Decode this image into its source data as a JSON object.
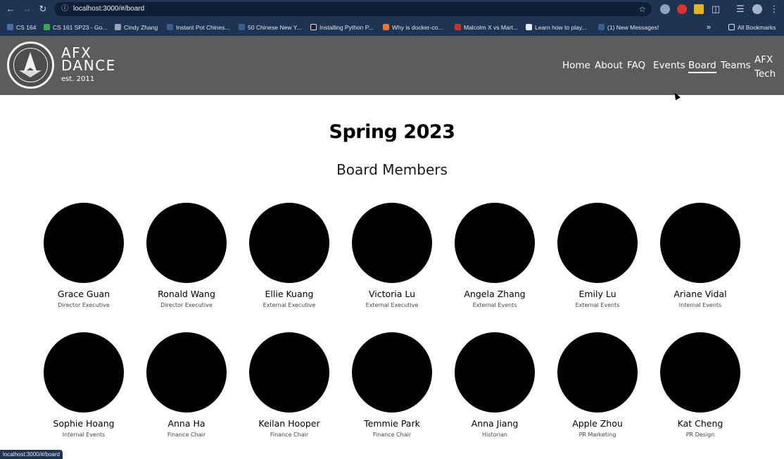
{
  "browser": {
    "url": "localhost:3000/#/board",
    "status_url": "localhost:3000/#/board",
    "bookmarks": [
      {
        "label": "CS 164",
        "color": "#4a6fa5"
      },
      {
        "label": "CS 161 SP23 - Go...",
        "color": "#34a853"
      },
      {
        "label": "Cindy Zhang",
        "color": "#9aa5b5"
      },
      {
        "label": "Instant Pot Chines...",
        "color": "#3b5d8f"
      },
      {
        "label": "50 Chinese New Y...",
        "color": "#3b5d8f"
      },
      {
        "label": "Installing Python P...",
        "color": "#202020"
      },
      {
        "label": "Why is docker-co...",
        "color": "#e5773b"
      },
      {
        "label": "Malcolm X vs Mart...",
        "color": "#c0392b"
      },
      {
        "label": "Learn how to play...",
        "color": "#e8edf5"
      },
      {
        "label": "(1) New Messages!",
        "color": "#3b5d8f"
      }
    ],
    "all_bookmarks": "All Bookmarks",
    "overflow": "»"
  },
  "site": {
    "brand_line1": "AFX",
    "brand_line2": "DANCE",
    "brand_est": "est. 2011",
    "nav": [
      "Home",
      "About",
      "FAQ",
      "Events",
      "Board",
      "Teams"
    ],
    "nav_active": "Board",
    "nav_multi_line1": "AFX",
    "nav_multi_line2": "Tech"
  },
  "main": {
    "season": "Spring 2023",
    "subtitle": "Board Members",
    "members": [
      {
        "name": "Grace Guan",
        "role": "Director Executive"
      },
      {
        "name": "Ronald Wang",
        "role": "Director Executive"
      },
      {
        "name": "Ellie Kuang",
        "role": "External Executive"
      },
      {
        "name": "Victoria Lu",
        "role": "External Executive"
      },
      {
        "name": "Angela Zhang",
        "role": "External Events"
      },
      {
        "name": "Emily Lu",
        "role": "External Events"
      },
      {
        "name": "Ariane Vidal",
        "role": "Internal Events"
      },
      {
        "name": "Sophie Hoang",
        "role": "Internal Events"
      },
      {
        "name": "Anna Ha",
        "role": "Finance Chair"
      },
      {
        "name": "Keilan Hooper",
        "role": "Finance Chair"
      },
      {
        "name": "Temmie Park",
        "role": "Finance Chair"
      },
      {
        "name": "Anna Jiang",
        "role": "Historian"
      },
      {
        "name": "Apple Zhou",
        "role": "PR Marketing"
      },
      {
        "name": "Kat Cheng",
        "role": "PR Design"
      }
    ]
  }
}
